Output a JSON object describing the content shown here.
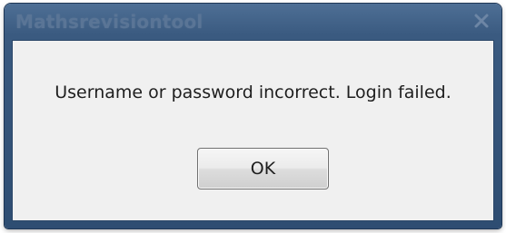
{
  "dialog": {
    "title": "Mathsrevisiontool",
    "message": "Username or password incorrect. Login failed.",
    "ok_label": "OK",
    "close_icon": "close-icon"
  },
  "colors": {
    "titlebar": "#3a5a80",
    "title_text": "#5a7596",
    "content_background": "#f0f0f0",
    "text": "#1e1e1e"
  }
}
